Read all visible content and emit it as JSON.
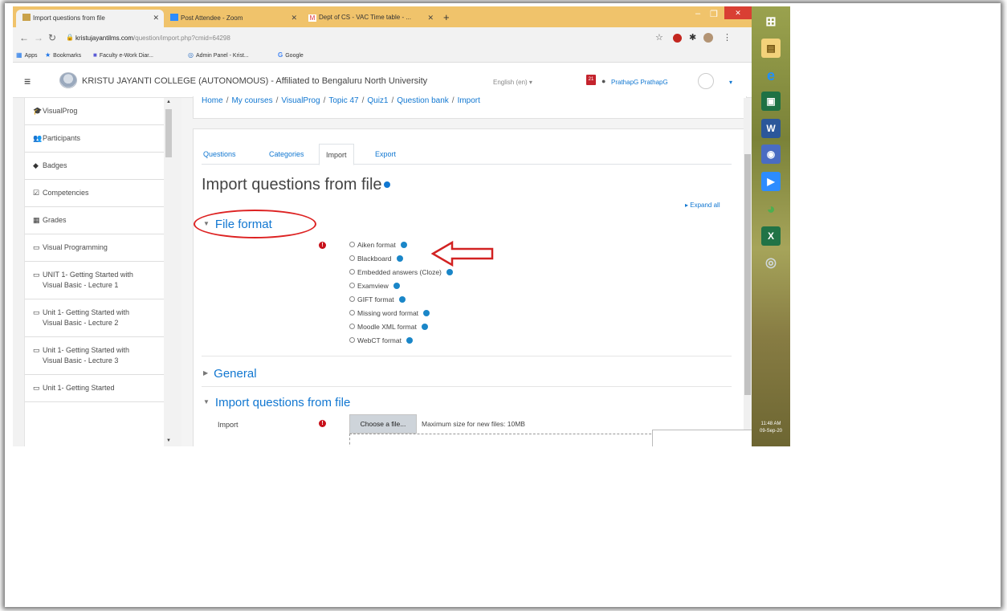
{
  "browser": {
    "tabs": [
      {
        "title": "Import questions from file",
        "active": true
      },
      {
        "title": "Post Attendee - Zoom",
        "active": false
      },
      {
        "title": "Dept of CS - VAC Time table - ...",
        "active": false
      }
    ],
    "url_host": "kristujayantilms.com",
    "url_path": "/question/import.php?cmid=64298",
    "bookmarks": [
      "Apps",
      "Bookmarks",
      "Faculty e-Work Diar...",
      "Admin Panel - Krist...",
      "Google"
    ]
  },
  "header": {
    "site_name": "KRISTU JAYANTI COLLEGE (AUTONOMOUS) - Affiliated to Bengaluru North University",
    "language": "English (en) ▾",
    "notification_count": "21",
    "user_name": "PrathapG PrathapG"
  },
  "drawer": {
    "items": [
      {
        "label": "VisualProg",
        "icon": "graduation-cap-icon",
        "glyph": "🎓"
      },
      {
        "label": "Participants",
        "icon": "users-icon",
        "glyph": "👥"
      },
      {
        "label": "Badges",
        "icon": "shield-icon",
        "glyph": "◆"
      },
      {
        "label": "Competencies",
        "icon": "checkbox-icon",
        "glyph": "☑"
      },
      {
        "label": "Grades",
        "icon": "table-icon",
        "glyph": "▦"
      },
      {
        "label": "Visual Programming",
        "icon": "folder-icon",
        "glyph": "▭"
      },
      {
        "label": "UNIT 1- Getting Started with Visual Basic - Lecture 1",
        "icon": "folder-icon",
        "glyph": "▭"
      },
      {
        "label": "Unit 1- Getting Started with Visual Basic - Lecture 2",
        "icon": "folder-icon",
        "glyph": "▭"
      },
      {
        "label": "Unit 1- Getting Started with Visual Basic - Lecture 3",
        "icon": "folder-icon",
        "glyph": "▭"
      },
      {
        "label": "Unit 1- Getting Started",
        "icon": "folder-icon",
        "glyph": "▭"
      }
    ]
  },
  "breadcrumb": [
    "Home",
    "My courses",
    "VisualProg",
    "Topic 47",
    "Quiz1",
    "Question bank",
    "Import"
  ],
  "tabs": [
    "Questions",
    "Categories",
    "Import",
    "Export"
  ],
  "page_title": "Import questions from file",
  "expand_all": "Expand all",
  "sections": {
    "file_format": "File format",
    "general": "General",
    "import_from_file": "Import questions from file"
  },
  "formats": [
    "Aiken format",
    "Blackboard",
    "Embedded answers (Cloze)",
    "Examview",
    "GIFT format",
    "Missing word format",
    "Moodle XML format",
    "WebCT format"
  ],
  "import_field": {
    "label": "Import",
    "button": "Choose a file...",
    "max_size": "Maximum size for new files: 10MB"
  },
  "taskbar": {
    "clock_time": "11:48 AM",
    "clock_date": "09-Sep-20"
  },
  "colors": {
    "link": "#1177d1",
    "annotation_red": "#d22222",
    "required": "#c8101a",
    "tabstrip": "#f0c36b"
  }
}
